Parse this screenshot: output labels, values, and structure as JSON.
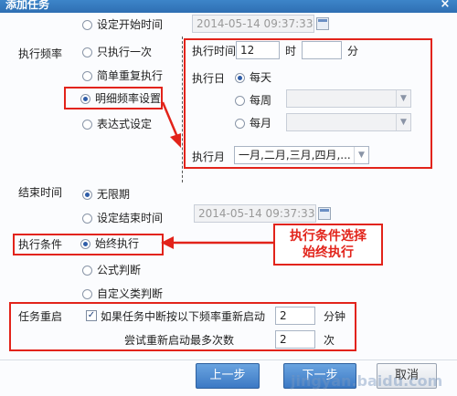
{
  "dialog": {
    "title": "添加任务",
    "close_glyph": "×"
  },
  "start": {
    "option_label": "设定开始时间",
    "datetime_value": "2014-05-14 09:37:33"
  },
  "frequency": {
    "section_label": "执行频率",
    "options": [
      "只执行一次",
      "简单重复执行",
      "明细频率设置",
      "表达式设定"
    ],
    "selected": "明细频率设置"
  },
  "detail": {
    "time_label": "执行时间",
    "hour_value": "12",
    "hour_unit": "时",
    "minute_value": "",
    "minute_unit": "分",
    "day_label": "执行日",
    "day_options": [
      "每天",
      "每周",
      "每月"
    ],
    "day_selected": "每天",
    "month_label": "执行月",
    "month_value": "一月,二月,三月,四月,..."
  },
  "end": {
    "section_label": "结束时间",
    "options": [
      "无限期",
      "设定结束时间"
    ],
    "selected": "无限期",
    "datetime_value": "2014-05-14 09:37:33"
  },
  "condition": {
    "section_label": "执行条件",
    "options": [
      "始终执行",
      "公式判断",
      "自定义类判断"
    ],
    "selected": "始终执行",
    "callout_line1": "执行条件选择",
    "callout_line2": "始终执行"
  },
  "restart": {
    "section_label": "任务重启",
    "checkbox_label": "如果任务中断按以下频率重新启动",
    "checked": true,
    "interval_value": "2",
    "interval_unit": "分钟",
    "retry_label": "尝试重新启动最多次数",
    "retry_value": "2",
    "retry_unit": "次"
  },
  "footer": {
    "prev_label": "上一步",
    "next_label": "下一步",
    "cancel_label": "取消",
    "watermark": "jingyan.baidu.com"
  },
  "colors": {
    "annotation_red": "#e2231a",
    "title_bar_blue": "#2f6fb3",
    "button_blue": "#3c79c4"
  }
}
